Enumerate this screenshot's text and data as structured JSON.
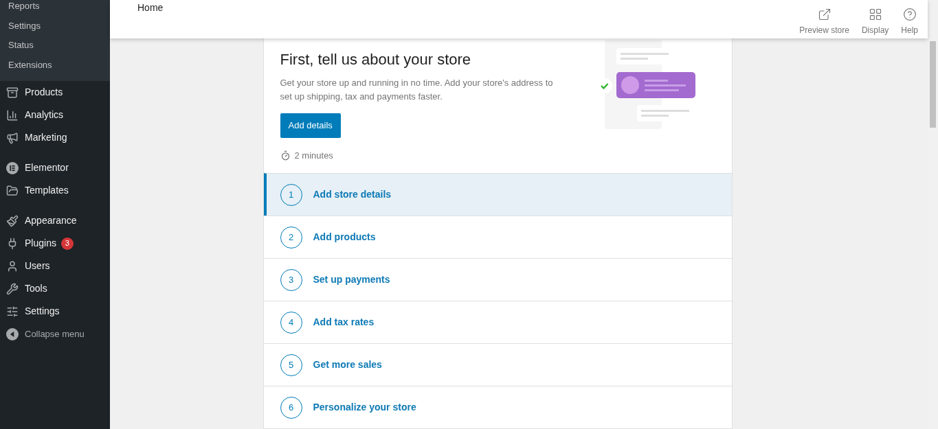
{
  "sidebar": {
    "submenu": [
      {
        "label": "Reports"
      },
      {
        "label": "Settings"
      },
      {
        "label": "Status"
      },
      {
        "label": "Extensions"
      }
    ],
    "groups": [
      [
        {
          "label": "Products"
        },
        {
          "label": "Analytics"
        },
        {
          "label": "Marketing"
        }
      ],
      [
        {
          "label": "Elementor"
        },
        {
          "label": "Templates"
        }
      ],
      [
        {
          "label": "Appearance"
        },
        {
          "label": "Plugins",
          "badge": "3"
        },
        {
          "label": "Users"
        },
        {
          "label": "Tools"
        },
        {
          "label": "Settings"
        }
      ]
    ],
    "collapse": "Collapse menu"
  },
  "header": {
    "title": "Home",
    "actions": [
      {
        "label": "Preview store"
      },
      {
        "label": "Display"
      },
      {
        "label": "Help"
      }
    ]
  },
  "intro": {
    "title": "First, tell us about your store",
    "description": "Get your store up and running in no time. Add your store's address to set up shipping, tax and payments faster.",
    "button": "Add details",
    "time": "2 minutes"
  },
  "steps": [
    {
      "number": "1",
      "label": "Add store details",
      "selected": true
    },
    {
      "number": "2",
      "label": "Add products",
      "selected": false
    },
    {
      "number": "3",
      "label": "Set up payments",
      "selected": false
    },
    {
      "number": "4",
      "label": "Add tax rates",
      "selected": false
    },
    {
      "number": "5",
      "label": "Get more sales",
      "selected": false
    },
    {
      "number": "6",
      "label": "Personalize your store",
      "selected": false
    }
  ]
}
